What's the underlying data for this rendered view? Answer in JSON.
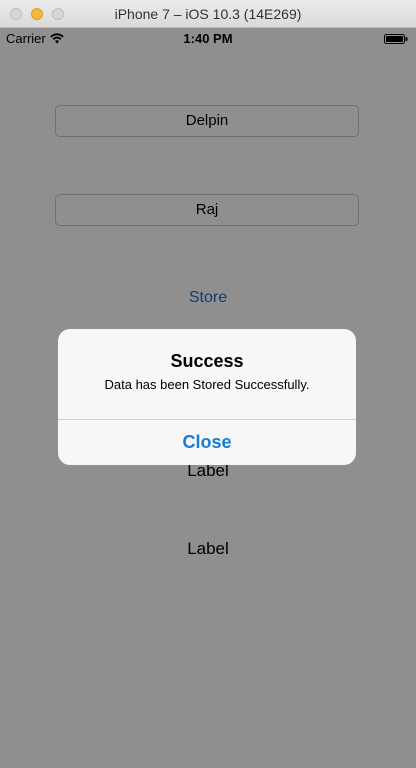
{
  "window": {
    "title": "iPhone 7 – iOS 10.3 (14E269)"
  },
  "status_bar": {
    "carrier": "Carrier",
    "time": "1:40 PM"
  },
  "form": {
    "first_name_value": "Delpin",
    "last_name_value": "Raj",
    "store_label": "Store",
    "label_1": "Label",
    "label_2": "Label"
  },
  "alert": {
    "title": "Success",
    "message": "Data has been Stored Successfully.",
    "close_label": "Close"
  },
  "colors": {
    "accent": "#1a7bd2",
    "overlay": "#8e8e8e"
  }
}
